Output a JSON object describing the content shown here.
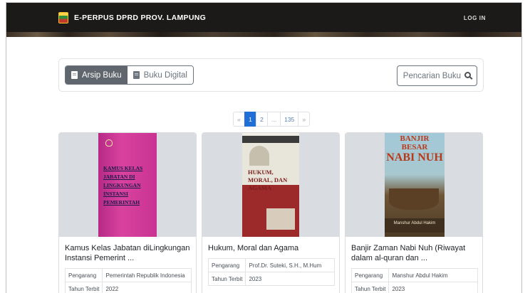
{
  "navbar": {
    "brand": "E-PERPUS DPRD PROV. LAMPUNG",
    "login_label": "LOG IN",
    "logo_icon": "lampung-emblem-icon"
  },
  "toolbar": {
    "tabs": [
      {
        "label": "Arsip Buku",
        "icon": "book-icon",
        "active": true
      },
      {
        "label": "Buku Digital",
        "icon": "book-icon",
        "active": false
      }
    ],
    "search_label": "Pencarian Buku",
    "search_icon": "search-icon"
  },
  "pagination": {
    "prev": "«",
    "pages": [
      "1",
      "2",
      "...",
      "135"
    ],
    "current": "1",
    "next": "»"
  },
  "labels": {
    "author": "Pengarang",
    "year": "Tahun Terbit"
  },
  "books": [
    {
      "title": "Kamus Kelas Jabatan diLingkungan Instansi Pemerint ...",
      "author": "Pemerintah Republik Indonesia",
      "year": "2022",
      "cover_text": "KAMUS KELAS JABATAN DI LINGKUNGAN INSTANSI PEMERINTAH"
    },
    {
      "title": "Hukum, Moral dan Agama",
      "author": "Prof.Dr. Suteki, S.H., M.Hum",
      "year": "2023",
      "cover_text": "HUKUM, MORAL, DAN AGAMA"
    },
    {
      "title": "Banjir Zaman Nabi Nuh (Riwayat dalam al-quran dan ...",
      "author": "Manshur Abdul Hakim",
      "year": "2023",
      "cover_title_top": "BANJIR BESAR",
      "cover_title_main": "NABI NUH",
      "cover_author": "Manshur Abdul Hakim"
    }
  ],
  "colors": {
    "accent": "#1f6fd6",
    "navbar": "#1c1a19",
    "tab_active": "#5f666d"
  }
}
